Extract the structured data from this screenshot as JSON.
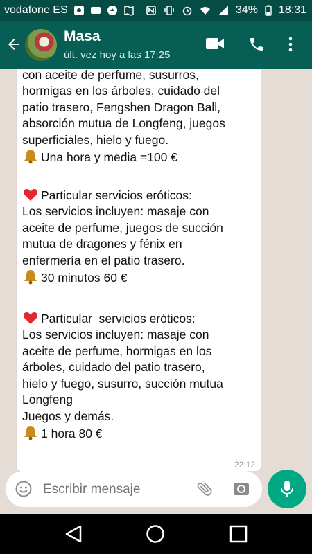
{
  "status_bar": {
    "carrier": "vodafone ES",
    "battery": "34%",
    "time": "18:31"
  },
  "header": {
    "contact_name": "Masa",
    "last_seen": "últ. vez hoy a las 17:25"
  },
  "message": {
    "lines": [
      "con aceite de perfume, susurros,",
      "hormigas en los árboles, cuidado del",
      "patio trasero, Fengshen Dragon Ball,",
      "absorción mutua de Longfeng, juegos",
      "superficiales, hielo y fuego.",
      "Una hora y media =100 €",
      "Particular servicios eróticos:",
      "Los servicios incluyen: masaje con",
      "aceite de perfume, juegos de succión",
      "mutua de dragones y fénix en",
      "enfermería en el patio trasero.",
      "30 minutos 60 €",
      "Particular  servicios eróticos:",
      "Los servicios incluyen: masaje con",
      "aceite de perfume, hormigas en los",
      "árboles, cuidado del patio trasero,",
      "hielo y fuego, susurro, succión mutua",
      "Longfeng",
      "Juegos y demás.",
      "1 hora 80 €"
    ],
    "timestamp": "22:12"
  },
  "composer": {
    "placeholder": "Escribir mensaje"
  },
  "icons": {
    "price_icon": "bell-icon",
    "heading_icon": "red-heart-icon"
  },
  "colors": {
    "header_bg": "#075e54",
    "status_bg": "#054d44",
    "accent": "#00a884",
    "chat_bg": "#e5ddd5"
  }
}
